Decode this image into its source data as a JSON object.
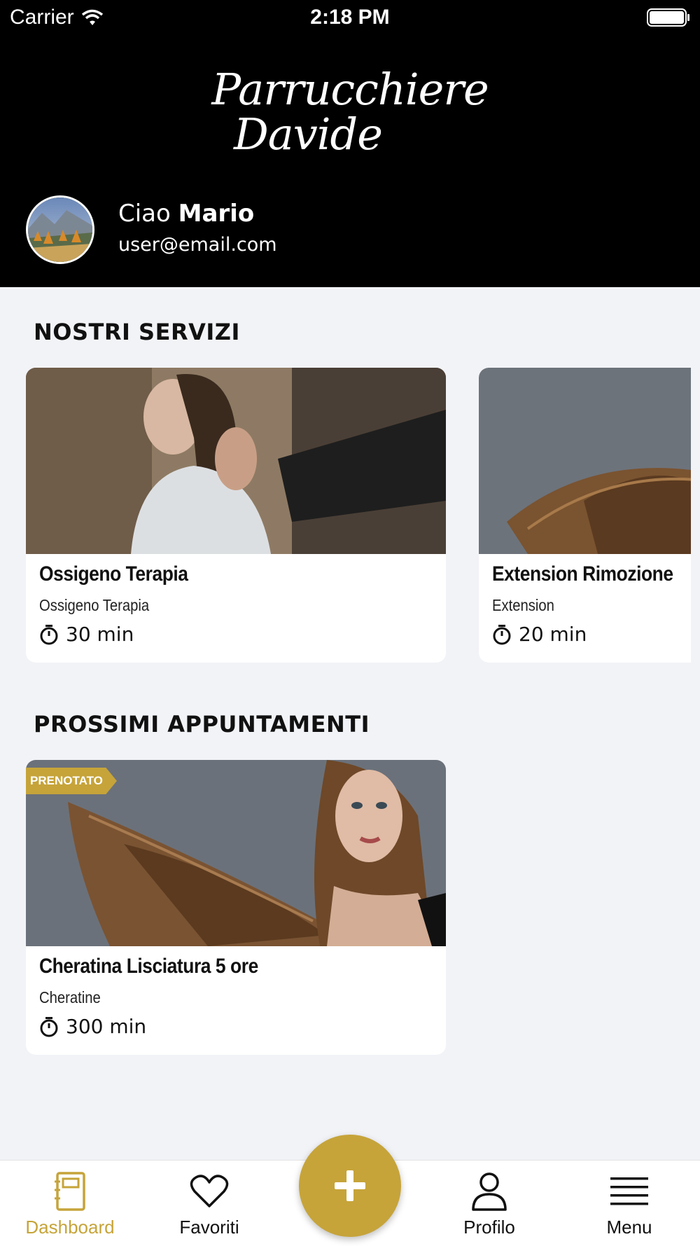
{
  "status_bar": {
    "carrier": "Carrier",
    "time": "2:18 PM"
  },
  "brand": {
    "line1": "Parrucchiere",
    "line2": "Davide"
  },
  "user": {
    "greeting": "Ciao",
    "name": "Mario",
    "email": "user@email.com"
  },
  "services": {
    "title": "NOSTRI SERVIZI",
    "items": [
      {
        "title": "Ossigeno Terapia",
        "subtitle": "Ossigeno Terapia",
        "duration": "30 min"
      },
      {
        "title": "Extension Rimozione",
        "subtitle": "Extension",
        "duration": "20 min"
      }
    ]
  },
  "appointments": {
    "title": "PROSSIMI APPUNTAMENTI",
    "items": [
      {
        "badge": "PRENOTATO",
        "title": "Cheratina Lisciatura 5 ore",
        "subtitle": "Cheratine",
        "duration": "300 min"
      }
    ]
  },
  "tabbar": {
    "dashboard": "Dashboard",
    "favorites": "Favoriti",
    "profile": "Profilo",
    "menu": "Menu",
    "active": "dashboard"
  },
  "colors": {
    "accent": "#c6a43a",
    "header_bg": "#000000",
    "page_bg": "#f2f3f7"
  },
  "icons": [
    "wifi-icon",
    "battery-icon",
    "timer-icon",
    "notebook-icon",
    "heart-icon",
    "plus-icon",
    "person-icon",
    "menu-icon"
  ]
}
